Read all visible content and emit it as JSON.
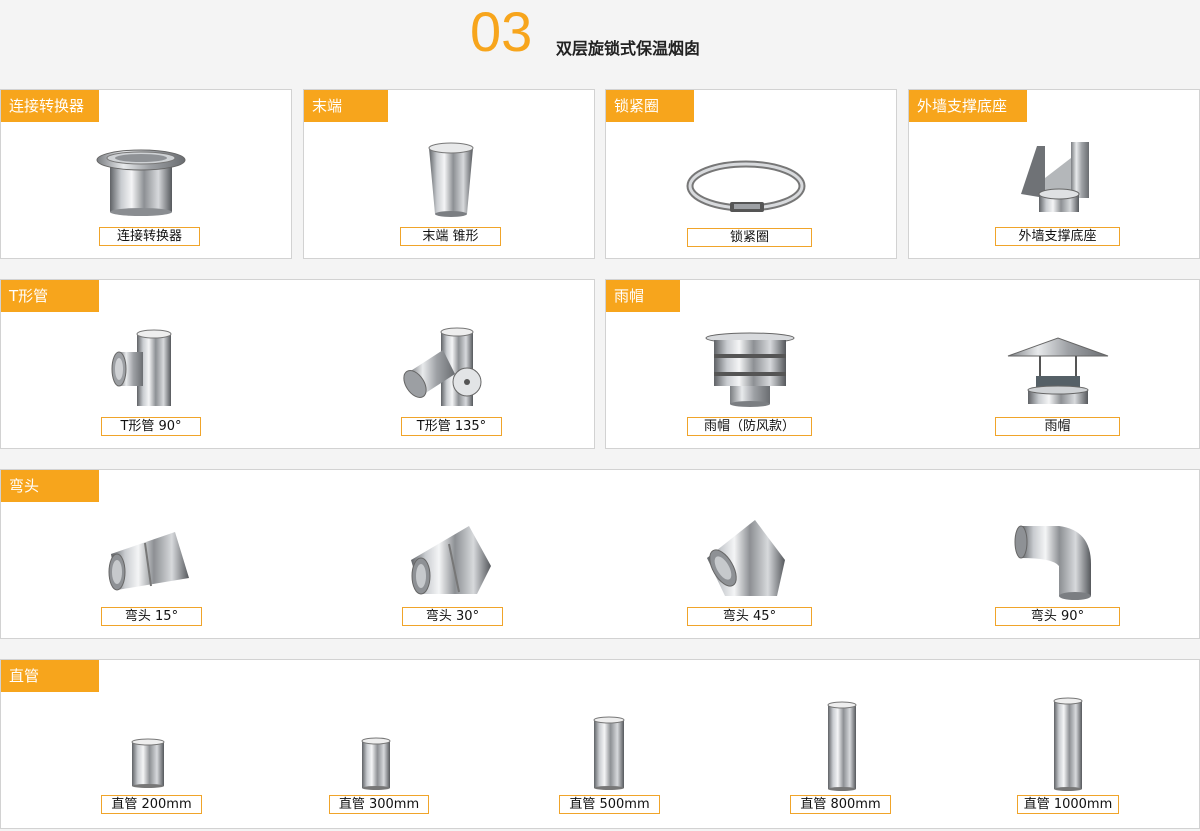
{
  "header": {
    "number": "03",
    "title": "双层旋锁式保温烟囱"
  },
  "sections": {
    "adapter": {
      "tab": "连接转换器",
      "caption": "连接转换器",
      "icon": "adapter-ring-icon"
    },
    "end": {
      "tab": "末端",
      "caption": "末端 锥形",
      "icon": "cone-end-icon"
    },
    "clamp": {
      "tab": "锁紧圈",
      "caption": "锁紧圈",
      "icon": "locking-band-icon"
    },
    "wall": {
      "tab": "外墙支撑底座",
      "caption": "外墙支撑底座",
      "icon": "wall-bracket-icon"
    },
    "tee": {
      "tab": "T形管",
      "items": [
        {
          "caption": "T形管 90°",
          "icon": "tee-90-icon"
        },
        {
          "caption": "T形管 135°",
          "icon": "tee-135-icon"
        }
      ]
    },
    "cap": {
      "tab": "雨帽",
      "items": [
        {
          "caption": "雨帽（防风款）",
          "icon": "windproof-cap-icon"
        },
        {
          "caption": "雨帽",
          "icon": "rain-cap-icon"
        }
      ]
    },
    "elbow": {
      "tab": "弯头",
      "items": [
        {
          "caption": "弯头 15°"
        },
        {
          "caption": "弯头 30°"
        },
        {
          "caption": "弯头 45°"
        },
        {
          "caption": "弯头 90°"
        }
      ]
    },
    "pipe": {
      "tab": "直管",
      "items": [
        {
          "caption": "直管 200mm"
        },
        {
          "caption": "直管 300mm"
        },
        {
          "caption": "直管 500mm"
        },
        {
          "caption": "直管 800mm"
        },
        {
          "caption": "直管 1000mm"
        }
      ]
    }
  },
  "colors": {
    "accent": "#f7a51c",
    "border": "#d2d2d2"
  }
}
